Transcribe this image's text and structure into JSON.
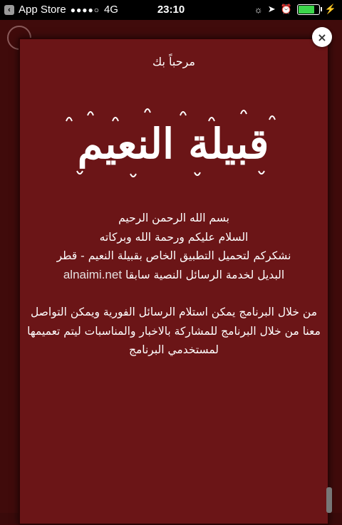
{
  "status_bar": {
    "back_app": "App Store",
    "signal": "●●●●○",
    "network": "4G",
    "time": "23:10",
    "icons": [
      "brightness-icon",
      "location-icon",
      "alarm-icon",
      "battery-icon",
      "charging-icon"
    ],
    "battery_level": 0.75,
    "battery_color": "#3cd64b"
  },
  "modal": {
    "welcome": "مرحباً بك",
    "logo_text": "قبيلة النعيم",
    "lines": [
      "بسم الله الرحمن الرحيم",
      "السلام عليكم ورحمة الله وبركاته",
      "نشكركم لتحميل التطبيق الخاص بقبيلة النعيم - قطر"
    ],
    "replacement_prefix": "البديل لخدمة الرسائل النصية سابقا",
    "site": "alnaimi.net",
    "paragraph": "من خلال البرنامج يمكن استلام الرسائل الفورية ويمكن التواصل معنا من خلال البرنامج للمشاركة بالاخبار والمناسبات ليتم تعميمها لمستخدمي البرنامج",
    "close_icon": "×"
  },
  "colors": {
    "modal_bg": "#6b1517",
    "page_bg": "#400b0b"
  }
}
